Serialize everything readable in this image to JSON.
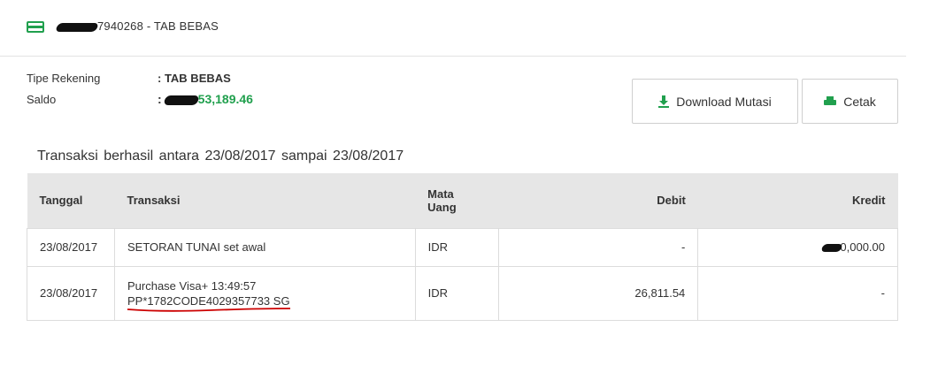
{
  "account": {
    "title": "7940268 - TAB BEBAS",
    "icon": "credit-card-icon"
  },
  "info": {
    "type_label": "Tipe Rekening",
    "type_value": ":  TAB BEBAS",
    "balance_label": "Saldo",
    "balance_prefix": ":",
    "balance_value": "53,189.46"
  },
  "buttons": {
    "download_label": "Download Mutasi",
    "print_label": "Cetak"
  },
  "caption": "Transaksi berhasil  antara  23/08/2017  sampai  23/08/2017",
  "table": {
    "headers": {
      "date": "Tanggal",
      "trx": "Transaksi",
      "currency_1": "Mata",
      "currency_2": "Uang",
      "debit": "Debit",
      "credit": "Kredit"
    },
    "rows": [
      {
        "date": "23/08/2017",
        "trx_line1": "SETORAN TUNAI set awal",
        "trx_line2": "",
        "currency": "IDR",
        "debit": "-",
        "credit": "0,000.00"
      },
      {
        "date": "23/08/2017",
        "trx_line1": "Purchase Visa+ 13:49:57",
        "trx_line2": "PP*1782CODE4029357733 SG",
        "currency": "IDR",
        "debit": "26,811.54",
        "credit": "-"
      }
    ]
  },
  "colors": {
    "accent": "#21a04e",
    "header_bg": "#e6e6e6",
    "annotation": "#cc0000"
  }
}
